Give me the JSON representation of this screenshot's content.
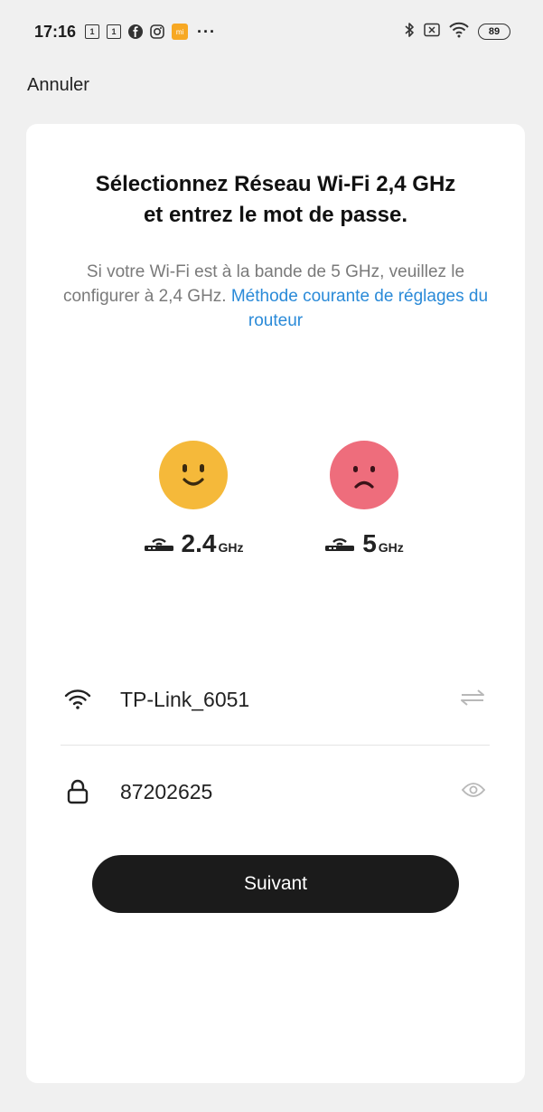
{
  "status_bar": {
    "time": "17:16",
    "notif_1": "1",
    "notif_2": "1",
    "mi_badge": "mi",
    "more": "···",
    "battery": "89"
  },
  "header": {
    "cancel_label": "Annuler"
  },
  "main": {
    "title_line1": "Sélectionnez Réseau Wi-Fi 2,4 GHz",
    "title_line2": "et entrez le mot de passe.",
    "subtitle_text": "Si votre Wi-Fi est à  la bande de 5 GHz, veuillez le configurer à 2,4 GHz.",
    "subtitle_link": "Méthode courante de réglages du routeur",
    "bands": [
      {
        "number": "2.4",
        "unit": "GHz",
        "face": "happy",
        "color": "#f5b93a"
      },
      {
        "number": "5",
        "unit": "GHz",
        "face": "sad",
        "color": "#ee6d7c"
      }
    ],
    "wifi_name": "TP-Link_6051",
    "password": "87202625",
    "next_label": "Suivant"
  },
  "icons": {
    "wifi": "wifi-icon",
    "lock": "lock-icon",
    "switch": "switch-arrows-icon",
    "eye": "eye-icon",
    "router": "router-icon"
  }
}
